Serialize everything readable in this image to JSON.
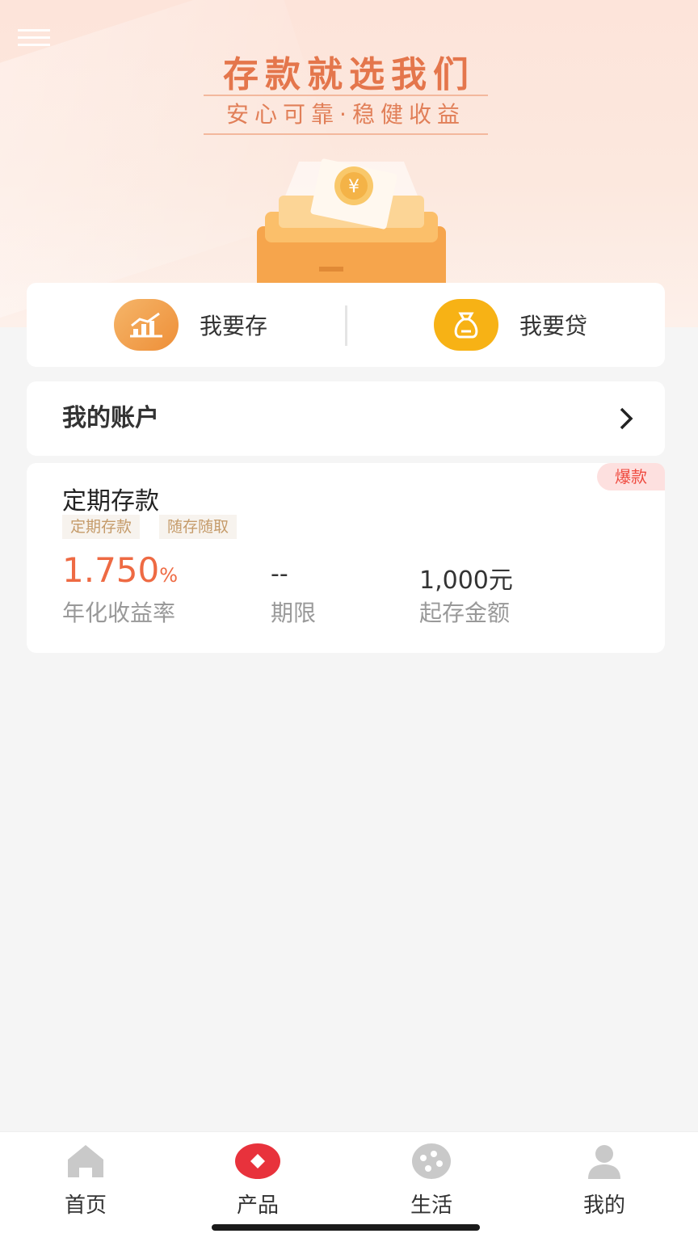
{
  "hero": {
    "title": "存款就选我们",
    "subtitle": "安心可靠·稳健收益",
    "coin_symbol": "¥"
  },
  "quick_actions": [
    {
      "label": "我要存",
      "icon": "chart-up-icon",
      "color": "#f0a04b"
    },
    {
      "label": "我要贷",
      "icon": "money-bag-icon",
      "color": "#f7b215"
    }
  ],
  "account": {
    "title": "我的账户",
    "arrow": "chevron-right-icon"
  },
  "product": {
    "badge": "爆款",
    "title": "定期存款",
    "tags": [
      "定期存款",
      "随存随取"
    ],
    "rate_value": "1.750",
    "rate_unit": "%",
    "rate_label": "年化收益率",
    "term_value": "--",
    "term_label": "期限",
    "min_value": "1,000元",
    "min_label": "起存金额"
  },
  "tabbar": {
    "active": "产品",
    "active_color": "#e8323c",
    "items": [
      {
        "label": "首页",
        "icon": "home-icon"
      },
      {
        "label": "产品",
        "icon": "product-icon"
      },
      {
        "label": "生活",
        "icon": "life-icon"
      },
      {
        "label": "我的",
        "icon": "user-icon"
      }
    ]
  }
}
